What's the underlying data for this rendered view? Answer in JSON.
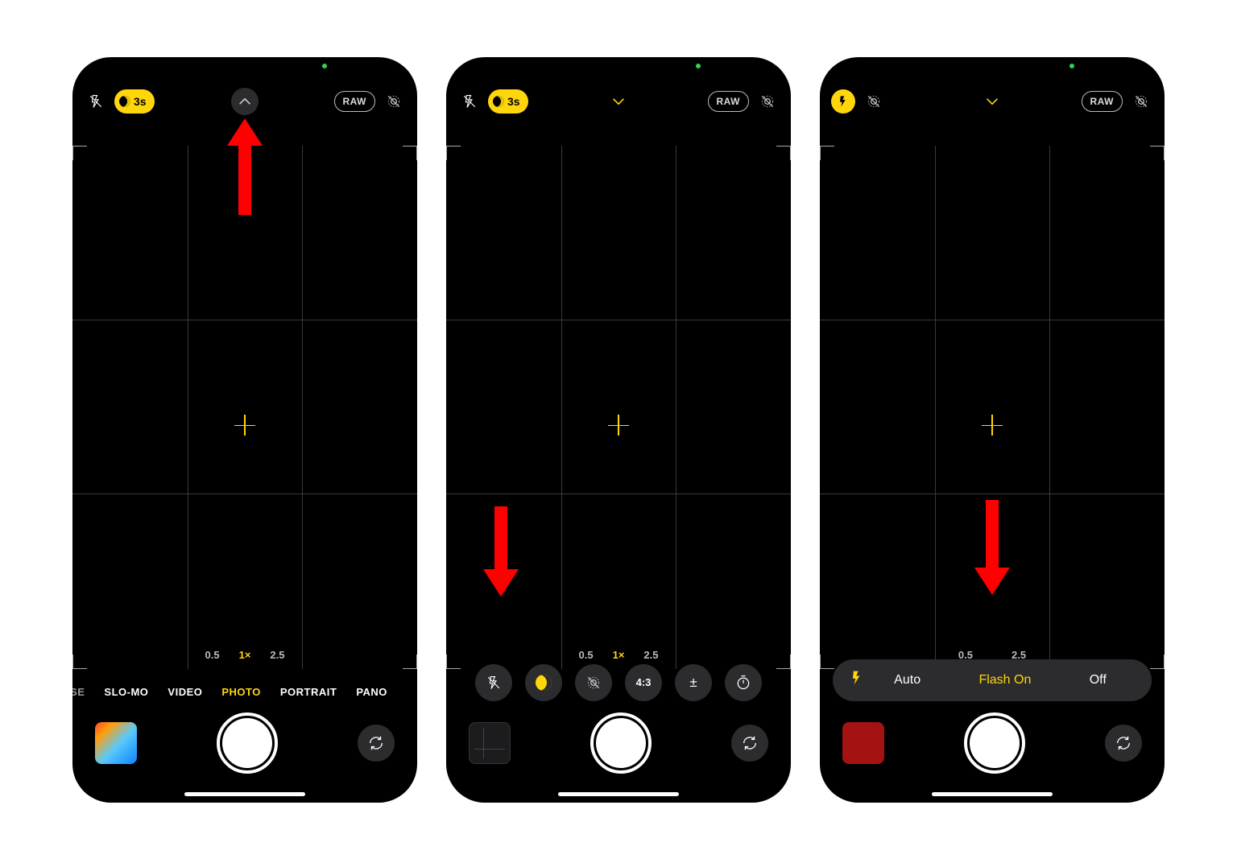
{
  "common": {
    "raw_label": "RAW",
    "night_timer": "3s",
    "zoom": {
      "wide": "0.5",
      "main": "1×",
      "tele": "2.5"
    },
    "icons": {
      "flash_off": "flash-off",
      "flash_on": "flash-on",
      "night": "night-mode",
      "live_off": "live-photo-off",
      "chevron_up": "chevron-up",
      "chevron_down": "chevron-down",
      "aspect": "4:3",
      "exposure": "±",
      "timer": "timer",
      "filters": "filters",
      "flip": "camera-flip"
    }
  },
  "s1": {
    "modes": [
      {
        "label": "SE",
        "active": false,
        "clip": true
      },
      {
        "label": "SLO-MO",
        "active": false
      },
      {
        "label": "VIDEO",
        "active": false
      },
      {
        "label": "PHOTO",
        "active": true
      },
      {
        "label": "PORTRAIT",
        "active": false
      },
      {
        "label": "PANO",
        "active": false
      }
    ]
  },
  "s2": {
    "tray": [
      {
        "name": "flash-off-icon"
      },
      {
        "name": "night-mode-icon",
        "active": true
      },
      {
        "name": "live-photo-off-icon"
      },
      {
        "name": "aspect-ratio",
        "text": "4:3"
      },
      {
        "name": "exposure-icon",
        "text": "±"
      },
      {
        "name": "timer-icon"
      }
    ]
  },
  "s3": {
    "flash_options": [
      {
        "label": "Auto",
        "active": false
      },
      {
        "label": "Flash On",
        "active": true
      },
      {
        "label": "Off",
        "active": false
      }
    ]
  }
}
